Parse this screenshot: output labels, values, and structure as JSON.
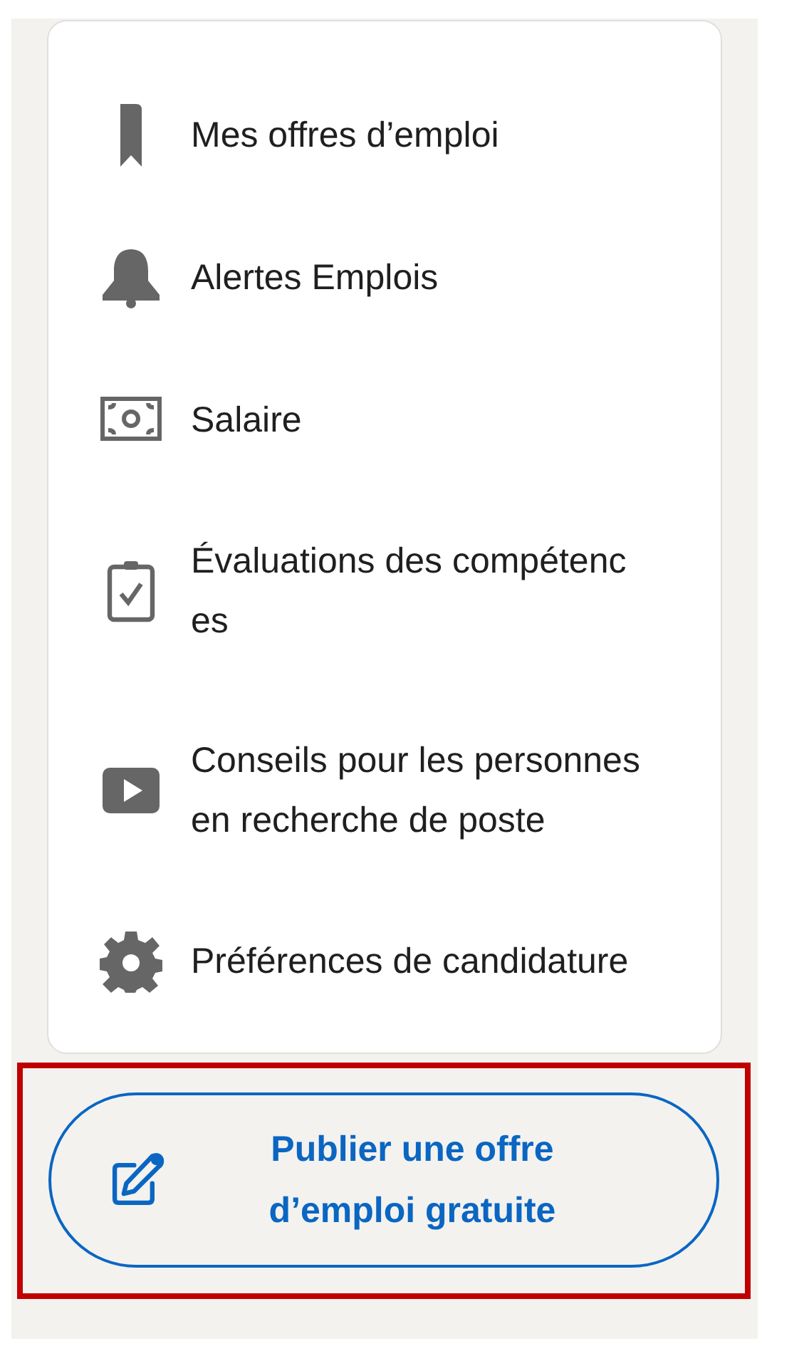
{
  "menu": {
    "items": [
      {
        "lines": [
          "Mes offres d’emploi"
        ]
      },
      {
        "lines": [
          "Alertes Emplois"
        ]
      },
      {
        "lines": [
          "Salaire"
        ]
      },
      {
        "lines": [
          "Évaluations des compétenc",
          "es"
        ]
      },
      {
        "lines": [
          "Conseils pour les personnes",
          "en recherche de poste"
        ]
      },
      {
        "lines": [
          "Préférences de candidature"
        ]
      }
    ]
  },
  "post_job_button": {
    "lines": [
      "Publier une offre",
      "d’emploi gratuite"
    ],
    "highlighted": true
  }
}
